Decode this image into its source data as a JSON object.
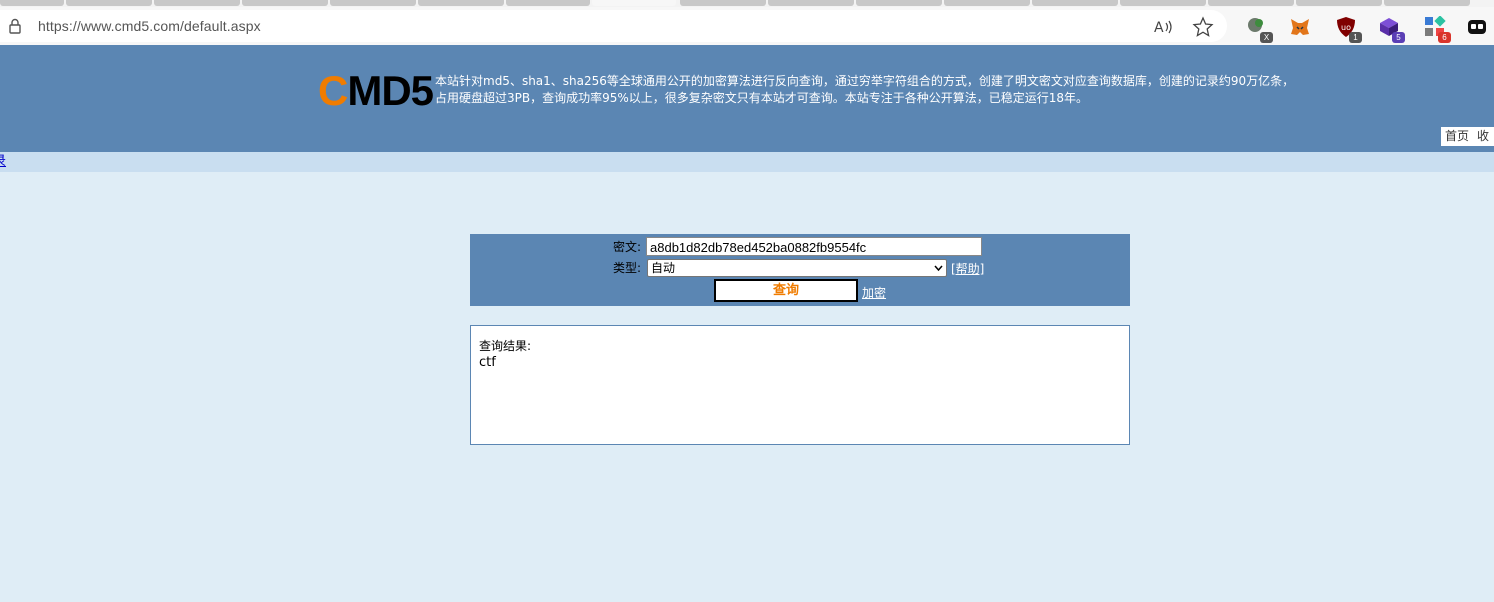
{
  "browser": {
    "url": "https://www.cmd5.com/default.aspx",
    "extensions": [
      {
        "name": "extension-x",
        "badge": "X",
        "badge_color": "#555555"
      },
      {
        "name": "metamask",
        "badge": "",
        "badge_color": ""
      },
      {
        "name": "ublock-origin",
        "badge": "1",
        "badge_color": "#555555"
      },
      {
        "name": "extension-purple",
        "badge": "5",
        "badge_color": "#5b3fb5"
      },
      {
        "name": "extension-grid",
        "badge": "6",
        "badge_color": "#d9342b"
      },
      {
        "name": "extension-mask",
        "badge": "",
        "badge_color": ""
      }
    ]
  },
  "header": {
    "logo_c": "C",
    "logo_rest": "MD5",
    "description_line1": "本站针对md5、sha1、sha256等全球通用公开的加密算法进行反向查询，通过穷举字符组合的方式，创建了明文密文对应查询数据库，创建的记录约90万亿条，",
    "description_line2": "占用硬盘超过3PB，查询成功率95%以上，很多复杂密文只有本站才可查询。本站专注于各种公开算法，已稳定运行18年。",
    "nav": [
      "首页",
      "收"
    ],
    "login_link": "录"
  },
  "query": {
    "cipher_label": "密文:",
    "cipher_value": "a8db1d82db78ed452ba0882fb9554fc",
    "type_label": "类型:",
    "type_value": "自动",
    "help_link": "[帮助]",
    "submit_label": "查询",
    "encrypt_link": "加密"
  },
  "result": {
    "title": "查询结果:",
    "value": "ctf"
  },
  "colors": {
    "header_bg": "#5b86b3",
    "page_bg": "#dfedf6",
    "accent_orange": "#f07c00"
  }
}
